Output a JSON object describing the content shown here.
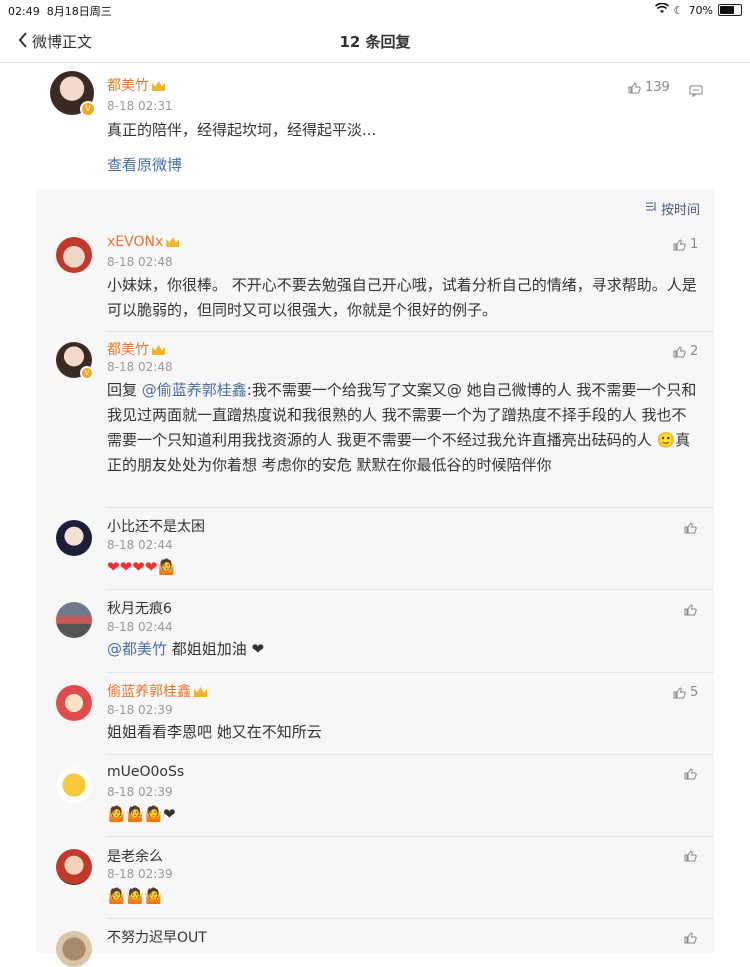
{
  "status": {
    "time": "02:49",
    "date": "8月18日周三",
    "battery": "70%",
    "battery_level": 0.7
  },
  "nav": {
    "back": "微博正文",
    "title": "12 条回复"
  },
  "main": {
    "user": "都美竹",
    "time": "8-18 02:31",
    "text": "真正的陪伴，经得起坎坷，经得起平淡...",
    "likes": "139",
    "view_original": "查看原微博"
  },
  "sort_label": "按时间",
  "replies": [
    {
      "user": "xEVONx",
      "time": "8-18 02:48",
      "likes": "1",
      "text": "小妹妹，你很棒。 不开心不要去勉强自己开心哦，试着分析自己的情绪，寻求帮助。人是可以脆弱的，但同时又可以很强大，你就是个很好的例子。"
    },
    {
      "user": "都美竹",
      "time": "8-18 02:48",
      "likes": "2",
      "prefix": "回复 ",
      "mention": "@偷蓝养郭桂鑫",
      "text": ":我不需要一个给我写了文案又@ 她自己微博的人 我不需要一个只和我见过两面就一直蹭热度说和我很熟的人 我不需要一个为了蹭热度不择手段的人 我也不需要一个只知道利用我找资源的人 我更不需要一个不经过我允许直播亮出砝码的人 🙂真正的朋友处处为你着想 考虑你的安危 默默在你最低谷的时候陪伴你"
    },
    {
      "user": "小比还不是太困",
      "time": "8-18 02:44",
      "likes": "",
      "text": "❤❤❤❤🤷"
    },
    {
      "user": "秋月无痕6",
      "time": "8-18 02:44",
      "likes": "",
      "mention": "@都美竹",
      "text": " 都姐姐加油 ❤"
    },
    {
      "user": "偷蓝养郭桂鑫",
      "time": "8-18 02:39",
      "likes": "5",
      "text": "姐姐看看李恩吧 她又在不知所云"
    },
    {
      "user": "mUeO0oSs",
      "time": "8-18 02:39",
      "likes": "",
      "text": "🤷🤷🤷❤"
    },
    {
      "user": "是老余么",
      "time": "8-18 02:39",
      "likes": "",
      "text": "🤷🤷🤷"
    },
    {
      "user": "不努力迟早OUT",
      "time": "",
      "likes": "",
      "text": ""
    }
  ]
}
